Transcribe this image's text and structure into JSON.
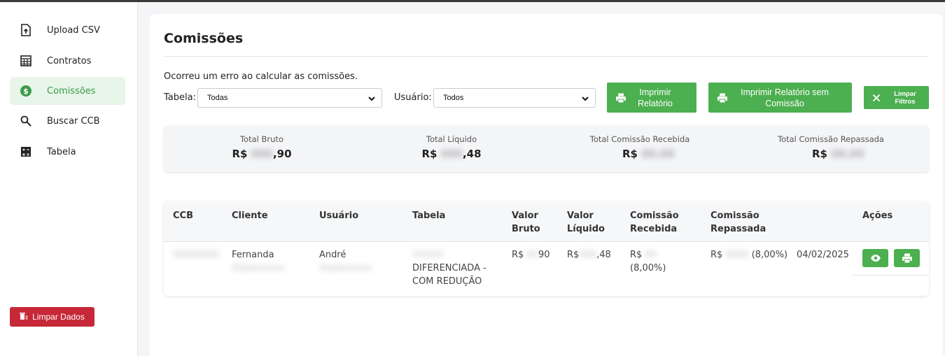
{
  "sidebar": {
    "items": [
      {
        "label": "Upload CSV",
        "icon": "file-upload-icon",
        "active": false
      },
      {
        "label": "Contratos",
        "icon": "table-grid-icon",
        "active": false
      },
      {
        "label": "Comissões",
        "icon": "dollar-circle-icon",
        "active": true
      },
      {
        "label": "Buscar CCB",
        "icon": "search-icon",
        "active": false
      },
      {
        "label": "Tabela",
        "icon": "calculator-icon",
        "active": false
      }
    ],
    "clear_data_label": "Limpar Dados"
  },
  "page": {
    "title": "Comissões",
    "error_message": "Ocorreu um erro ao calcular as comissões."
  },
  "filters": {
    "tabela_label": "Tabela:",
    "tabela_value": "Todas",
    "usuario_label": "Usuário:",
    "usuario_value": "Todos"
  },
  "buttons": {
    "print_report": "Imprimir Relatório",
    "print_report_no_commission": "Imprimir Relatório sem Comissão",
    "clear_filters": "Limpar Filtros"
  },
  "totals": [
    {
      "label": "Total Bruto",
      "currency": "R$",
      "value": ",90"
    },
    {
      "label": "Total Líquido",
      "currency": "R$",
      "value": ",48"
    },
    {
      "label": "Total Comissão Recebida",
      "currency": "R$",
      "value": ""
    },
    {
      "label": "Total Comissão Repassada",
      "currency": "R$",
      "value": ""
    }
  ],
  "table": {
    "headers": {
      "ccb": "CCB",
      "cliente": "Cliente",
      "usuario": "Usuário",
      "tabela": "Tabela",
      "valor_bruto": "Valor Bruto",
      "valor_liquido": "Valor Líquido",
      "comissao_recebida": "Comissão Recebida",
      "comissao_repassada": "Comissão Repassada",
      "acoes": "Ações"
    },
    "rows": [
      {
        "cliente": "Fernanda",
        "usuario": "André",
        "tabela": "DIFERENCIADA - COM REDUÇÃO",
        "valor_bruto_prefix": "R$",
        "valor_bruto_suffix": "90",
        "valor_liquido_prefix": "R$",
        "valor_liquido_suffix": ",48",
        "comissao_recebida_prefix": "R$",
        "comissao_recebida_pct": "(8,00%)",
        "comissao_repassada_prefix": "R$",
        "comissao_repassada_pct": "(8,00%)",
        "data": "04/02/2025"
      }
    ]
  },
  "colors": {
    "accent_green": "#4caf50",
    "danger_red": "#c62838",
    "active_bg": "#e8f5e9"
  }
}
